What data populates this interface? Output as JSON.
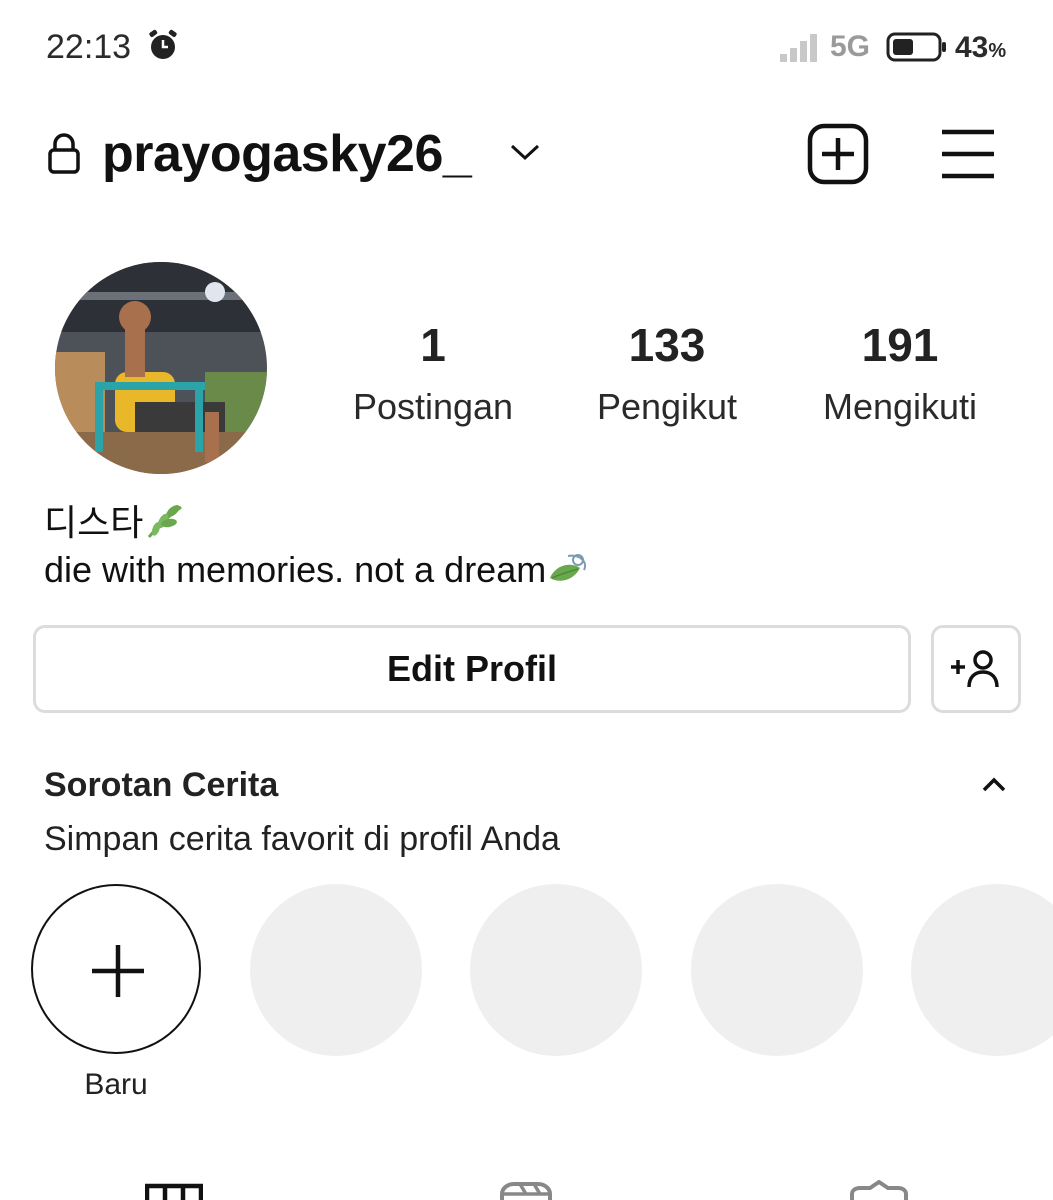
{
  "status_bar": {
    "time": "22:13",
    "network": "5G",
    "battery_percent": "43",
    "battery_unit": "%",
    "icons": [
      "alarm-icon",
      "signal-icon",
      "battery-icon"
    ]
  },
  "header": {
    "username": "prayogasky26_",
    "icons": [
      "lock-icon",
      "chevron-down-icon",
      "add-post-icon",
      "menu-icon"
    ]
  },
  "stats": [
    {
      "value": "1",
      "label": "Postingan"
    },
    {
      "value": "133",
      "label": "Pengikut"
    },
    {
      "value": "191",
      "label": "Mengikuti"
    }
  ],
  "profile": {
    "display_name": "디스타",
    "bio": "die with memories. not a dream"
  },
  "actions": {
    "edit_profile": "Edit Profil"
  },
  "highlights": {
    "title": "Sorotan Cerita",
    "subtitle": "Simpan cerita favorit di profil Anda",
    "new_label": "Baru"
  },
  "bottom_tabs": [
    "grid-icon",
    "reels-icon",
    "tagged-icon"
  ],
  "colors": {
    "text": "#111111",
    "border": "#dcdcdc",
    "placeholder": "#efefef",
    "leaf_green": "#6aa84f"
  }
}
